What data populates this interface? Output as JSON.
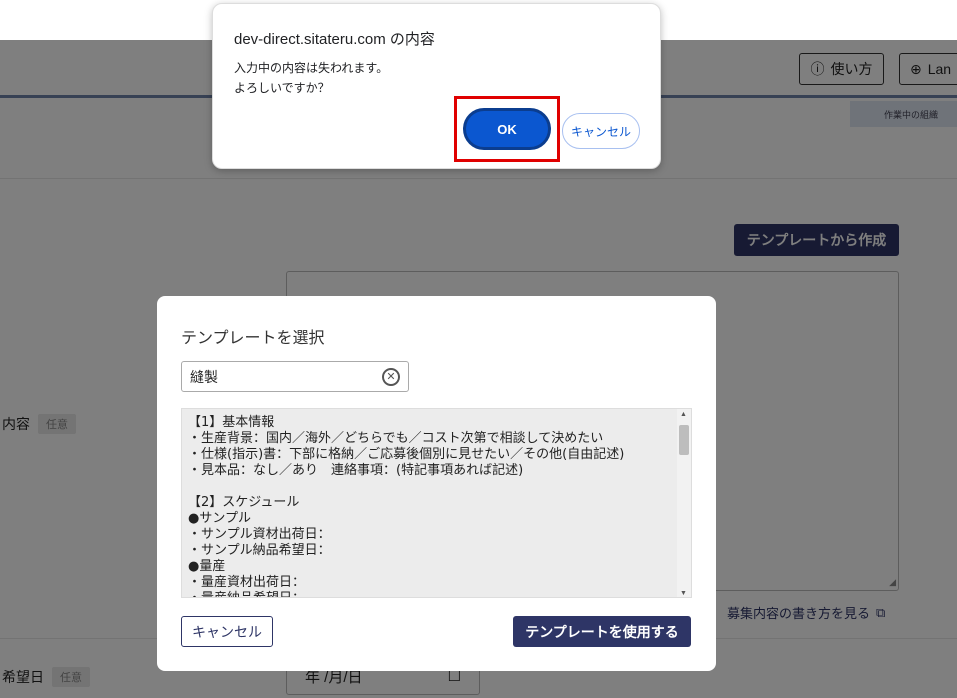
{
  "confirm_dialog": {
    "title": "dev-direct.sitateru.com の内容",
    "message": "入力中の内容は失われます。\nよろしいですか？",
    "ok_label": "OK",
    "cancel_label": "キャンセル"
  },
  "header": {
    "help_label": "使い方",
    "lang_label": "Lan",
    "org_tab_label": "作業中の組織"
  },
  "form": {
    "template_create_label": "テンプレートから作成",
    "content_label": "内容",
    "optional_badge": "任意",
    "howto_link": "募集内容の書き方を見る",
    "date_label": "希望日",
    "date_placeholder": "年 /月/日"
  },
  "template_modal": {
    "title": "テンプレートを選択",
    "search_value": "縫製",
    "body_text": "【1】基本情報\n・生産背景：国内／海外／どちらでも／コスト次第で相談して決めたい\n・仕様(指示)書：下部に格納／ご応募後個別に見せたい／その他(自由記述)\n・見本品：なし／あり　連絡事項：(特記事項あれば記述)\n\n【2】スケジュール\n●サンプル\n・サンプル資材出荷日：\n・サンプル納品希望日：\n●量産\n・量産資材出荷日：\n・量産納品希望日：",
    "cancel_label": "キャンセル",
    "use_label": "テンプレートを使用する"
  },
  "colors": {
    "brand": "#2e3566",
    "ok_blue": "#0b57d0",
    "highlight_red": "#e00000"
  }
}
